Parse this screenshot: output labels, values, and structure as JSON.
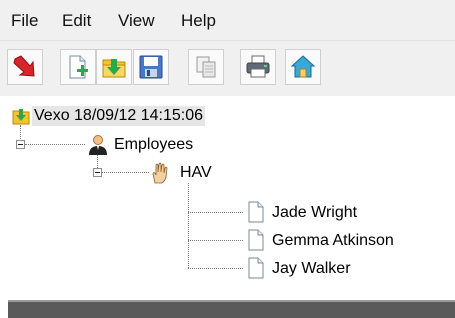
{
  "menu": {
    "items": [
      "File",
      "Edit",
      "View",
      "Help"
    ]
  },
  "toolbar": {
    "buttons": [
      {
        "icon": "red-arrow-down-icon"
      },
      {
        "icon": "new-document-icon"
      },
      {
        "icon": "open-folder-icon"
      },
      {
        "icon": "save-disk-icon"
      },
      {
        "icon": "copy-icon"
      },
      {
        "icon": "printer-icon"
      },
      {
        "icon": "home-icon"
      }
    ]
  },
  "tree": {
    "root": {
      "label": "Vexo 18/09/12 14:15:06",
      "icon": "folder-arrow-icon"
    },
    "group": {
      "label": "Employees",
      "icon": "person-icon"
    },
    "subgroup": {
      "label": "HAV",
      "icon": "hand-icon"
    },
    "leaves": [
      "Jade Wright",
      "Gemma Atkinson",
      "Jay Walker"
    ]
  }
}
